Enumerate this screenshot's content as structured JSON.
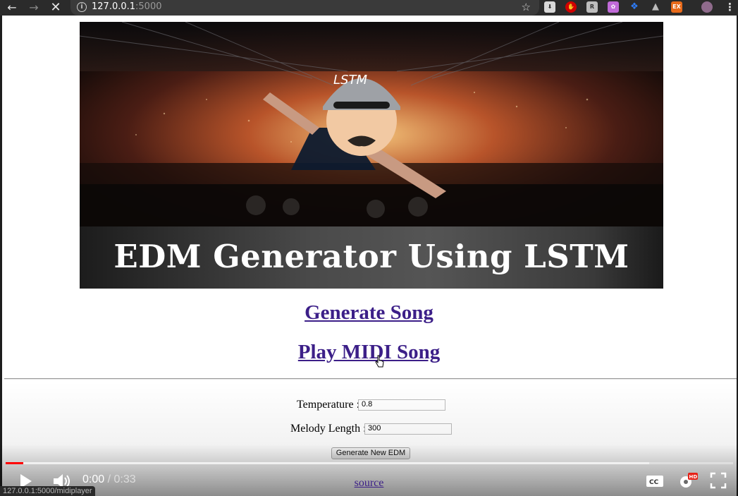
{
  "browser": {
    "url_host": "127.0.0.1",
    "url_port": ":5000",
    "icons": [
      "back-arrow-icon",
      "forward-arrow-icon",
      "stop-loading-icon",
      "site-info-icon",
      "bookmark-star-icon",
      "menu-icon"
    ]
  },
  "banner": {
    "badge_text": "LSTM",
    "title": "EDM Generator Using LSTM"
  },
  "links": {
    "generate_song": "Generate Song",
    "play_midi_song": "Play MIDI Song",
    "source": "source"
  },
  "form": {
    "temperature_label": "Temperature :",
    "temperature_value": "0.8",
    "melody_length_label": "Melody Length :",
    "melody_length_value": "300",
    "generate_button": "Generate New EDM"
  },
  "video": {
    "current_time": "0:00",
    "separator": " / ",
    "duration": "0:33",
    "played_fraction": 0.024,
    "buffered_fraction": 0.885,
    "quality_badge": "HD"
  },
  "status_bar": {
    "text": "127.0.0.1:5000/midiplayer"
  },
  "colors": {
    "link": "#3c1f88",
    "progress_played": "#ff0000",
    "toolbar": "#2b2b2b"
  }
}
